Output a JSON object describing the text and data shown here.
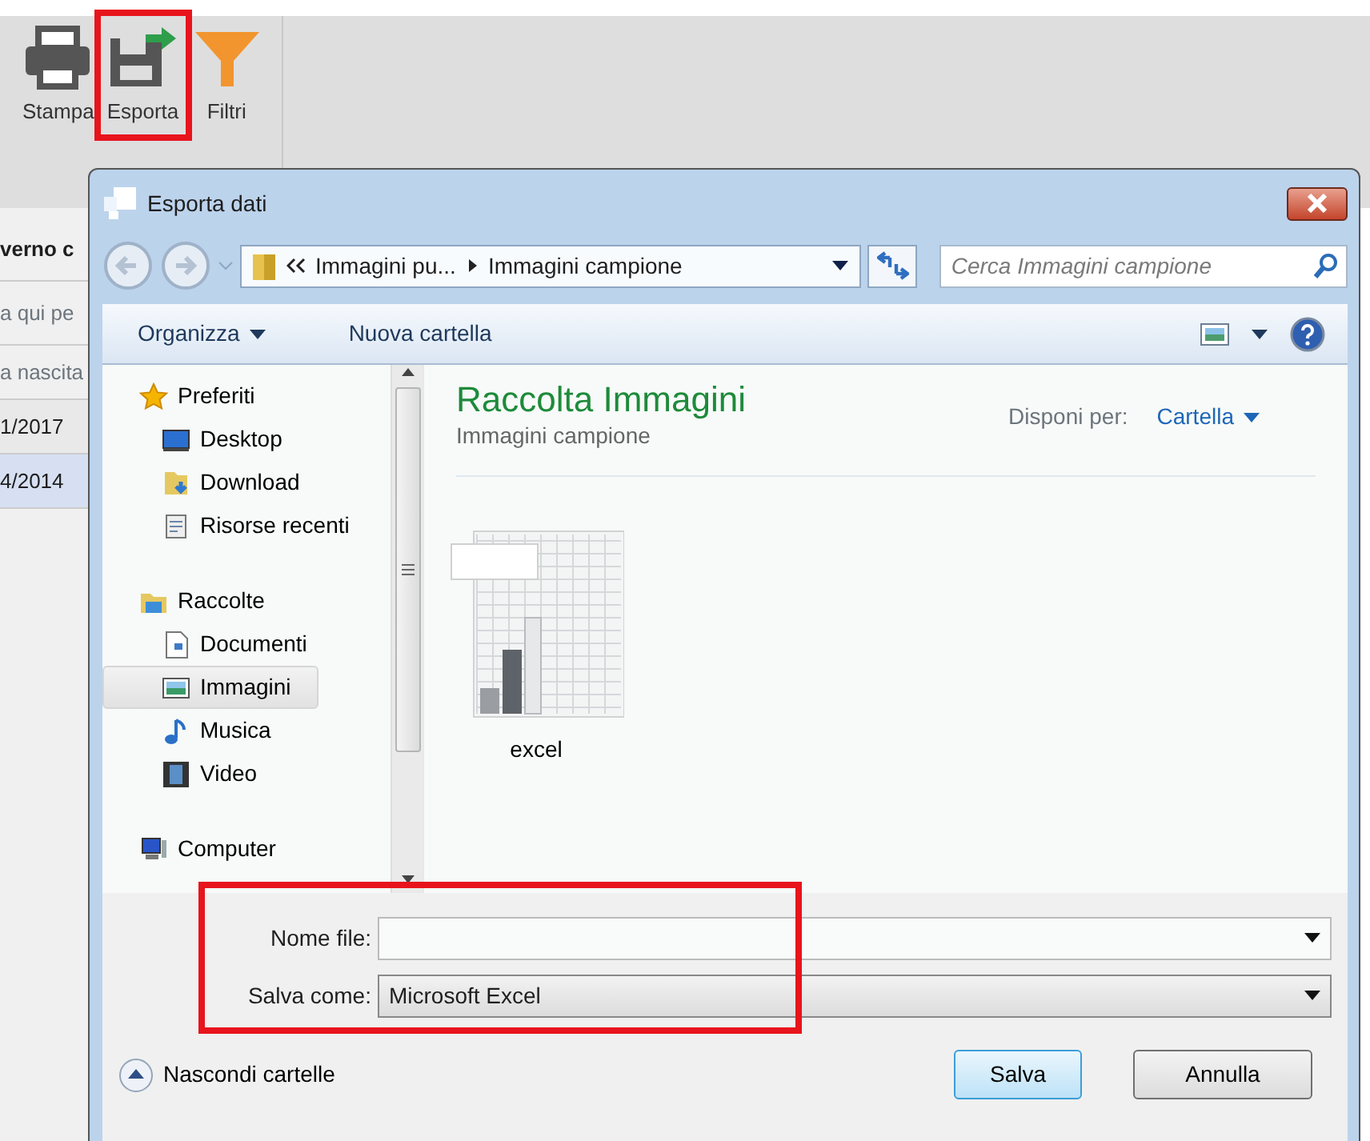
{
  "ribbon": {
    "buttons": [
      {
        "label": "Stampa",
        "highlighted": false
      },
      {
        "label": "Esporta",
        "highlighted": true
      },
      {
        "label": "Filtri",
        "highlighted": false
      }
    ]
  },
  "background_panel": {
    "title": "verno c",
    "filter_placeholder": "a qui pe",
    "column": "a nascita",
    "rows": [
      {
        "text": "1/2017",
        "selected": false
      },
      {
        "text": "4/2014",
        "selected": true
      }
    ]
  },
  "dialog": {
    "title": "Esporta dati",
    "breadcrumb": [
      "Immagini pu...",
      "Immagini campione"
    ],
    "search_placeholder": "Cerca Immagini campione",
    "commands": [
      "Organizza",
      "Nuova cartella"
    ],
    "nav": [
      {
        "label": "Preferiti",
        "selected": false,
        "children": [
          {
            "label": "Desktop",
            "selected": false
          },
          {
            "label": "Download",
            "selected": false
          },
          {
            "label": "Risorse recenti",
            "selected": false
          }
        ]
      },
      {
        "label": "Raccolte",
        "selected": false,
        "children": [
          {
            "label": "Documenti",
            "selected": false
          },
          {
            "label": "Immagini",
            "selected": true
          },
          {
            "label": "Musica",
            "selected": false
          },
          {
            "label": "Video",
            "selected": false
          }
        ]
      },
      {
        "label": "Computer",
        "selected": false
      }
    ],
    "library_title": "Raccolta Immagini",
    "library_subtitle": "Immagini campione",
    "arrange_label": "Disponi per:",
    "arrange_value": "Cartella",
    "files": [
      {
        "name": "excel"
      }
    ],
    "fields": [
      {
        "label": "Nome file:",
        "kind": "combo"
      },
      {
        "label": "Salva come:",
        "kind": "select",
        "value": "Microsoft Excel"
      }
    ],
    "fields_highlighted": true,
    "hide_folders": "Nascondi cartelle",
    "buttons": [
      {
        "label": "Salva",
        "default": true
      },
      {
        "label": "Annulla",
        "default": false
      }
    ]
  }
}
